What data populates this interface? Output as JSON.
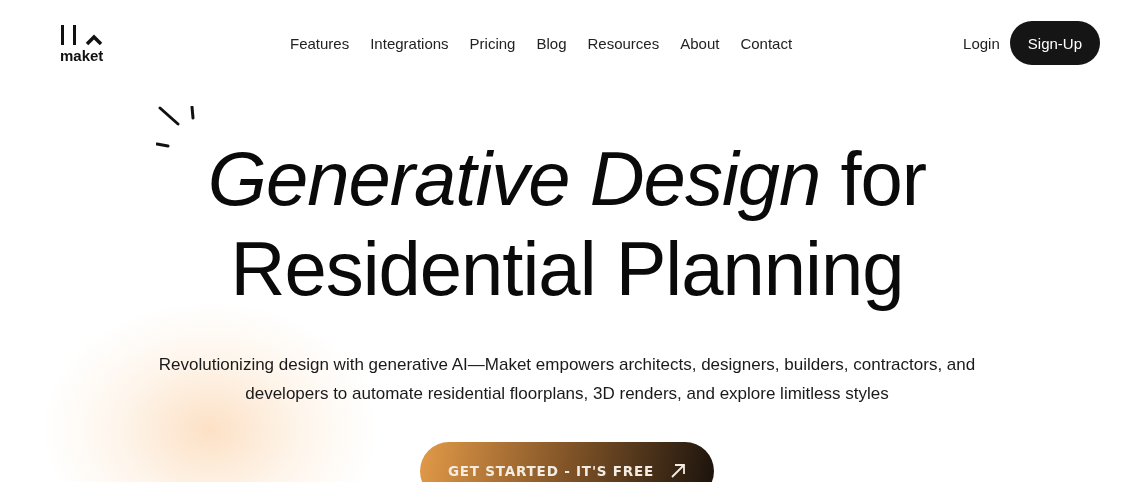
{
  "logo": {
    "text": "maket"
  },
  "nav": [
    "Features",
    "Integrations",
    "Pricing",
    "Blog",
    "Resources",
    "About",
    "Contact"
  ],
  "auth": {
    "login": "Login",
    "signup": "Sign-Up"
  },
  "hero": {
    "headline_lines": [
      "*Generative Design* for",
      "Residential Planning"
    ],
    "subtitle": "Revolutionizing design with generative AI—Maket empowers architects, designers, builders, contractors, and developers to automate residential floorplans, 3D renders, and explore limitless styles",
    "cta": "GET STARTED - IT'S FREE"
  }
}
